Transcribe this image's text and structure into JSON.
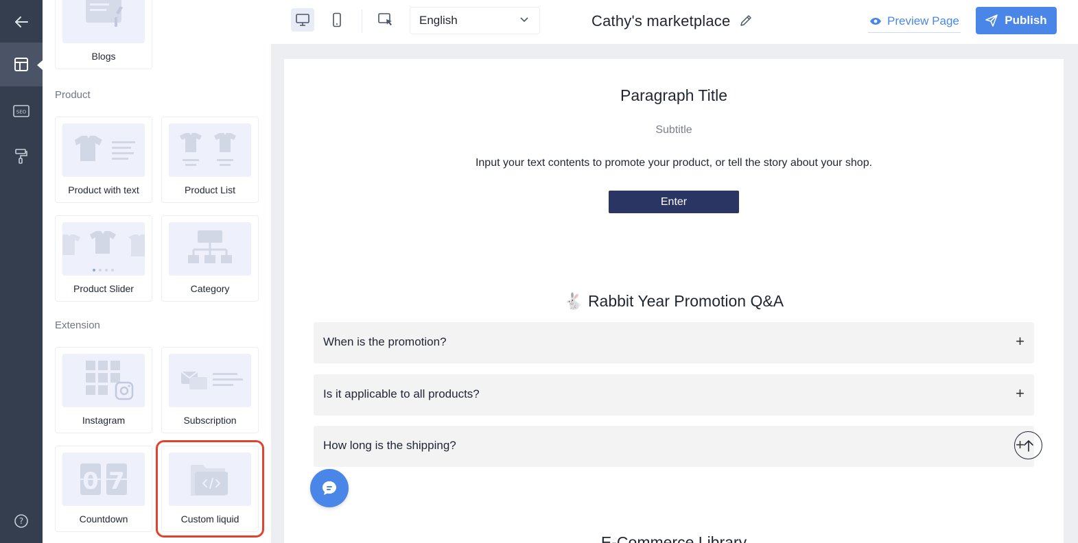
{
  "rail": {
    "icons": [
      "back-arrow-icon",
      "layout-icon",
      "seo-icon",
      "paint-roller-icon",
      "help-icon"
    ],
    "seo_text": "SEO",
    "help_text": "?"
  },
  "library": {
    "top_card": {
      "label": "Blogs"
    },
    "sections": [
      {
        "title": "Product",
        "cards": [
          {
            "label": "Product with text"
          },
          {
            "label": "Product List"
          },
          {
            "label": "Product Slider"
          },
          {
            "label": "Category"
          }
        ]
      },
      {
        "title": "Extension",
        "cards": [
          {
            "label": "Instagram"
          },
          {
            "label": "Subscription"
          },
          {
            "label": "Countdown"
          },
          {
            "label": "Custom liquid"
          }
        ]
      }
    ]
  },
  "topbar": {
    "language": "English",
    "site_title": "Cathy's marketplace",
    "preview_label": "Preview Page",
    "publish_label": "Publish"
  },
  "canvas": {
    "paragraph_title": "Paragraph Title",
    "subtitle": "Subtitle",
    "body": "Input your text contents to promote your product, or tell the story about your shop.",
    "button_label": "Enter",
    "faq_title": "🐇 Rabbit Year Promotion Q&A",
    "faq": [
      {
        "question": "When is the promotion?"
      },
      {
        "question": "Is it applicable to all products?"
      },
      {
        "question": "How long is the shipping?"
      }
    ],
    "next_section_title": "E-Commerce Library"
  },
  "colors": {
    "rail_bg": "#353e4f",
    "accent": "#4a86e8",
    "enter_button": "#2b3563",
    "highlight": "#e0442f"
  }
}
